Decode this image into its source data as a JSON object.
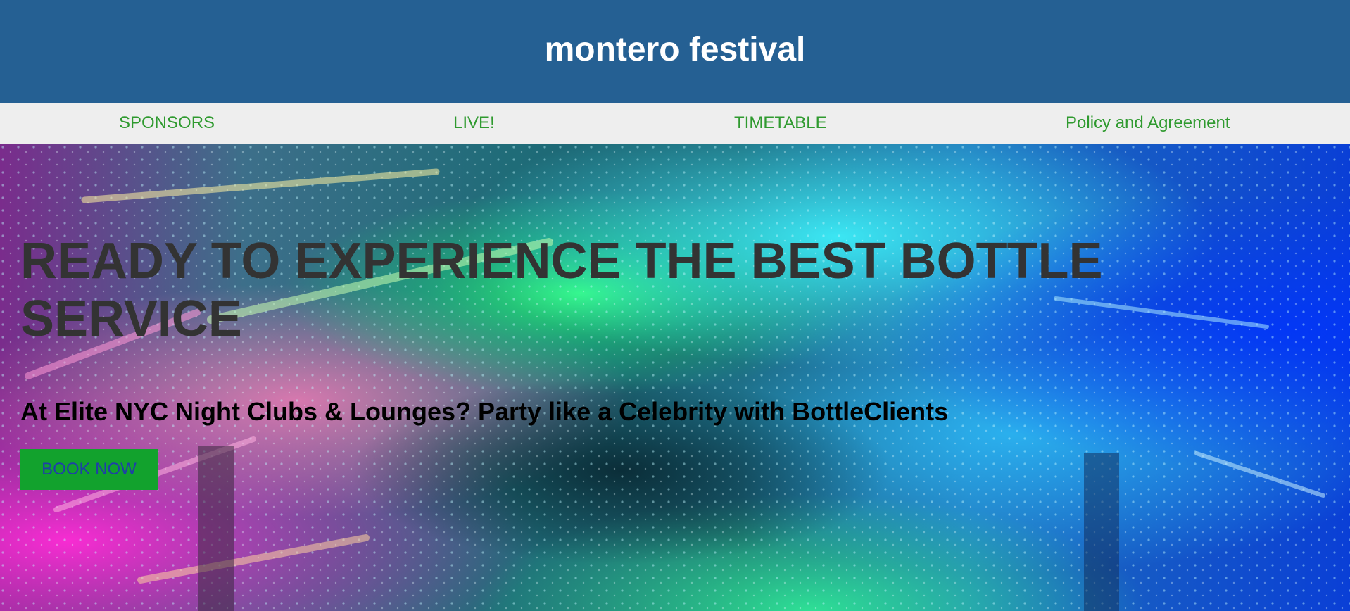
{
  "header": {
    "title": "montero festival"
  },
  "nav": {
    "items": [
      {
        "label": "SPONSORS"
      },
      {
        "label": "LIVE!"
      },
      {
        "label": "TIMETABLE"
      },
      {
        "label": "Policy and Agreement"
      }
    ]
  },
  "hero": {
    "heading": "READY TO EXPERIENCE THE BEST BOTTLE SERVICE",
    "subheading": "At Elite NYC Night Clubs & Lounges? Party like a Celebrity with BottleClients",
    "button_label": "BOOK NOW"
  },
  "colors": {
    "header_bg": "#256093",
    "nav_bg": "#eeeeee",
    "nav_link": "#2f9a2f",
    "button_bg": "#12a22d",
    "button_text": "#1f3fa8",
    "heading_text": "#333333"
  }
}
